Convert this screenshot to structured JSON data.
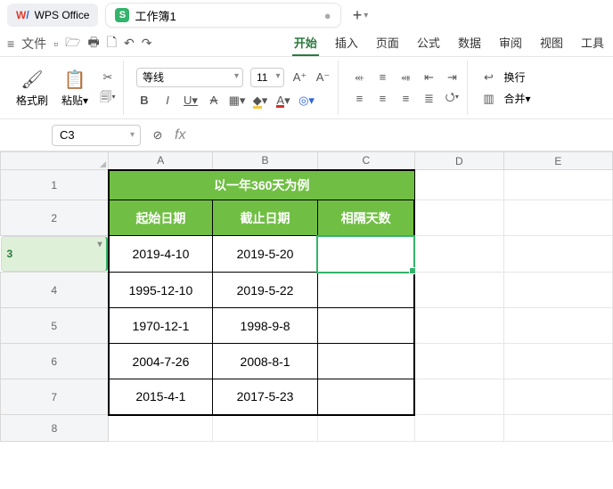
{
  "titlebar": {
    "app_name": "WPS Office",
    "workbook_name": "工作簿1",
    "sheets_badge": "S",
    "new_tab": "+"
  },
  "menubar": {
    "file": "文件",
    "tabs": [
      "开始",
      "插入",
      "页面",
      "公式",
      "数据",
      "审阅",
      "视图",
      "工具"
    ],
    "active_tab": 0
  },
  "ribbon": {
    "brush": "格式刷",
    "paste": "粘贴",
    "font_name": "等线",
    "font_size": "11",
    "wrap": "换行",
    "merge": "合并"
  },
  "namebox": {
    "ref": "C3"
  },
  "formulabar": {
    "fx": "fx"
  },
  "grid": {
    "col_labels": [
      "A",
      "B",
      "C",
      "D",
      "E"
    ],
    "row_labels": [
      "1",
      "2",
      "3",
      "4",
      "5",
      "6",
      "7",
      "8"
    ],
    "title": "以一年360天为例",
    "headers": {
      "A": "起始日期",
      "B": "截止日期",
      "C": "相隔天数"
    },
    "rows": [
      {
        "A": "2019-4-10",
        "B": "2019-5-20",
        "C": ""
      },
      {
        "A": "1995-12-10",
        "B": "2019-5-22",
        "C": ""
      },
      {
        "A": "1970-12-1",
        "B": "1998-9-8",
        "C": ""
      },
      {
        "A": "2004-7-26",
        "B": "2008-8-1",
        "C": ""
      },
      {
        "A": "2015-4-1",
        "B": "2017-5-23",
        "C": ""
      }
    ]
  }
}
